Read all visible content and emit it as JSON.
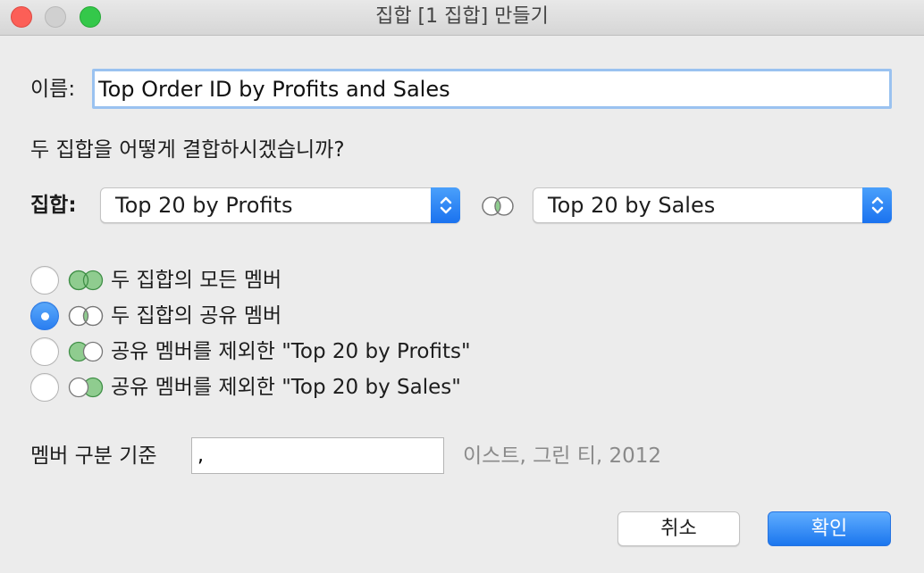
{
  "window": {
    "title": "집합 [1 집합] 만들기"
  },
  "name_field": {
    "label": "이름:",
    "value": "Top Order ID by Profits and Sales"
  },
  "question": "두 집합을 어떻게 결합하시겠습니까?",
  "sets": {
    "label": "집합:",
    "left_value": "Top 20 by Profits",
    "right_value": "Top 20 by Sales"
  },
  "options": [
    {
      "label": "두 집합의 모든 멤버",
      "selected": false,
      "venn": "union-icon"
    },
    {
      "label": "두 집합의 공유 멤버",
      "selected": true,
      "venn": "intersection-icon"
    },
    {
      "label": "공유 멤버를 제외한 \"Top 20 by Profits\"",
      "selected": false,
      "venn": "left-except-icon"
    },
    {
      "label": "공유 멤버를 제외한 \"Top 20 by Sales\"",
      "selected": false,
      "venn": "right-except-icon"
    }
  ],
  "separator": {
    "label": "멤버 구분 기준",
    "value": ",",
    "example": "이스트, 그린 티, 2012"
  },
  "buttons": {
    "cancel": "취소",
    "ok": "확인"
  },
  "colors": {
    "accent": "#2a7ef0",
    "venn_fill": "#8fcc8f",
    "venn_stroke": "#3f8f46"
  }
}
